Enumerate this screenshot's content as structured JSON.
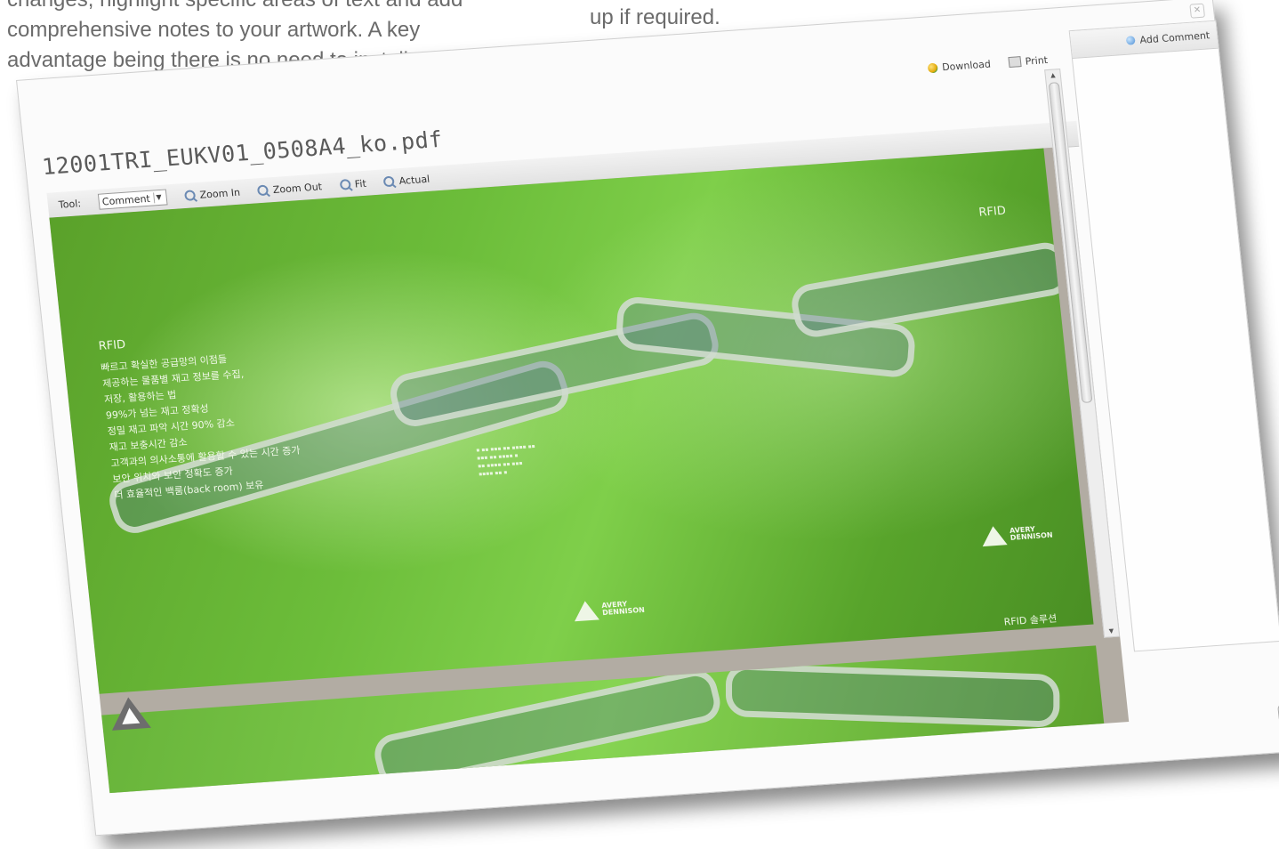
{
  "intro": {
    "left_lines": [
      "changes, highlight specific areas of text and add",
      "comprehensive notes to your artwork. A key",
      "advantage being there is no need to install"
    ],
    "right_line": "up if required."
  },
  "viewer": {
    "filename": "12001TRI_EUKV01_0508A4_ko.pdf",
    "download": "Download",
    "print": "Print",
    "add_comment": "Add Comment",
    "tool_label": "Tool:",
    "tool_value": "Comment",
    "zoom_in": "Zoom In",
    "zoom_out": "Zoom Out",
    "fit": "Fit",
    "actual": "Actual"
  },
  "page": {
    "rfid_heading": "RFID",
    "rfid_lines": [
      "빠르고 확실한 공급망의 이점들",
      "제공하는 물품별 재고 정보를 수집,",
      "저장, 활용하는 법",
      "99%가 넘는 재고 정확성",
      "정밀 재고 파악 시간 90% 감소",
      "재고 보충시간 감소",
      "고객과의 의사소통에 활용할 수 있는 시간 증가",
      "보안 위치와 보안 정확도 증가",
      "더 효율적인 백룸(back room) 보유"
    ],
    "rfid_right": "RFID",
    "rfid_bottom": "RFID 솔루션",
    "logo_text_1": "AVERY",
    "logo_text_2": "DENNISON"
  },
  "icons": {
    "download": "download-icon",
    "print": "print-icon",
    "zoom": "magnifier-icon",
    "add_comment": "add-comment-icon",
    "close": "close-icon"
  }
}
